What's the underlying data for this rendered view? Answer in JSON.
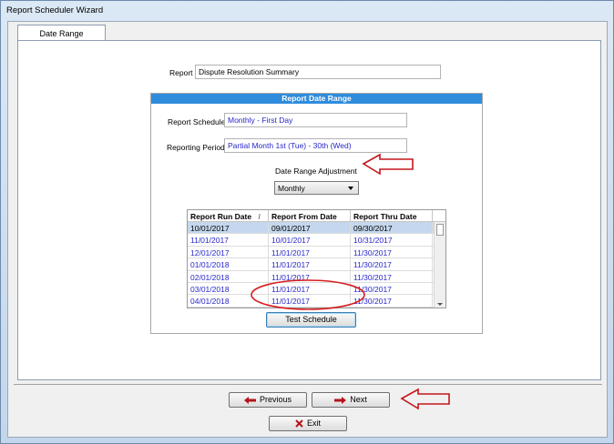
{
  "window": {
    "title": "Report Scheduler Wizard"
  },
  "tabs": [
    {
      "label": "Date Range"
    }
  ],
  "report": {
    "label": "Report",
    "value": "Dispute Resolution Summary"
  },
  "group": {
    "title": "Report Date Range",
    "schedule_label": "Report Schedule",
    "schedule_value": "Monthly - First Day",
    "period_label": "Reporting Period",
    "period_value": "Partial Month 1st (Tue) - 30th (Wed)",
    "adjust_label": "Date Range Adjustment",
    "adjust_value": "Monthly",
    "test_button": "Test Schedule"
  },
  "grid": {
    "columns": [
      "Report Run Date",
      "Report From Date",
      "Report Thru Date"
    ],
    "sort_indicator": "/",
    "rows": [
      [
        "10/01/2017",
        "09/01/2017",
        "09/30/2017"
      ],
      [
        "11/01/2017",
        "10/01/2017",
        "10/31/2017"
      ],
      [
        "12/01/2017",
        "11/01/2017",
        "11/30/2017"
      ],
      [
        "01/01/2018",
        "11/01/2017",
        "11/30/2017"
      ],
      [
        "02/01/2018",
        "11/01/2017",
        "11/30/2017"
      ],
      [
        "03/01/2018",
        "11/01/2017",
        "11/30/2017"
      ],
      [
        "04/01/2018",
        "11/01/2017",
        "11/30/2017"
      ]
    ]
  },
  "nav": {
    "previous": "Previous",
    "next": "Next",
    "exit": "Exit"
  },
  "colors": {
    "header_blue": "#2f8cdc",
    "value_blue": "#2727c9",
    "annotation_red": "#d81e1e",
    "arrow_red": "#c4161c"
  }
}
